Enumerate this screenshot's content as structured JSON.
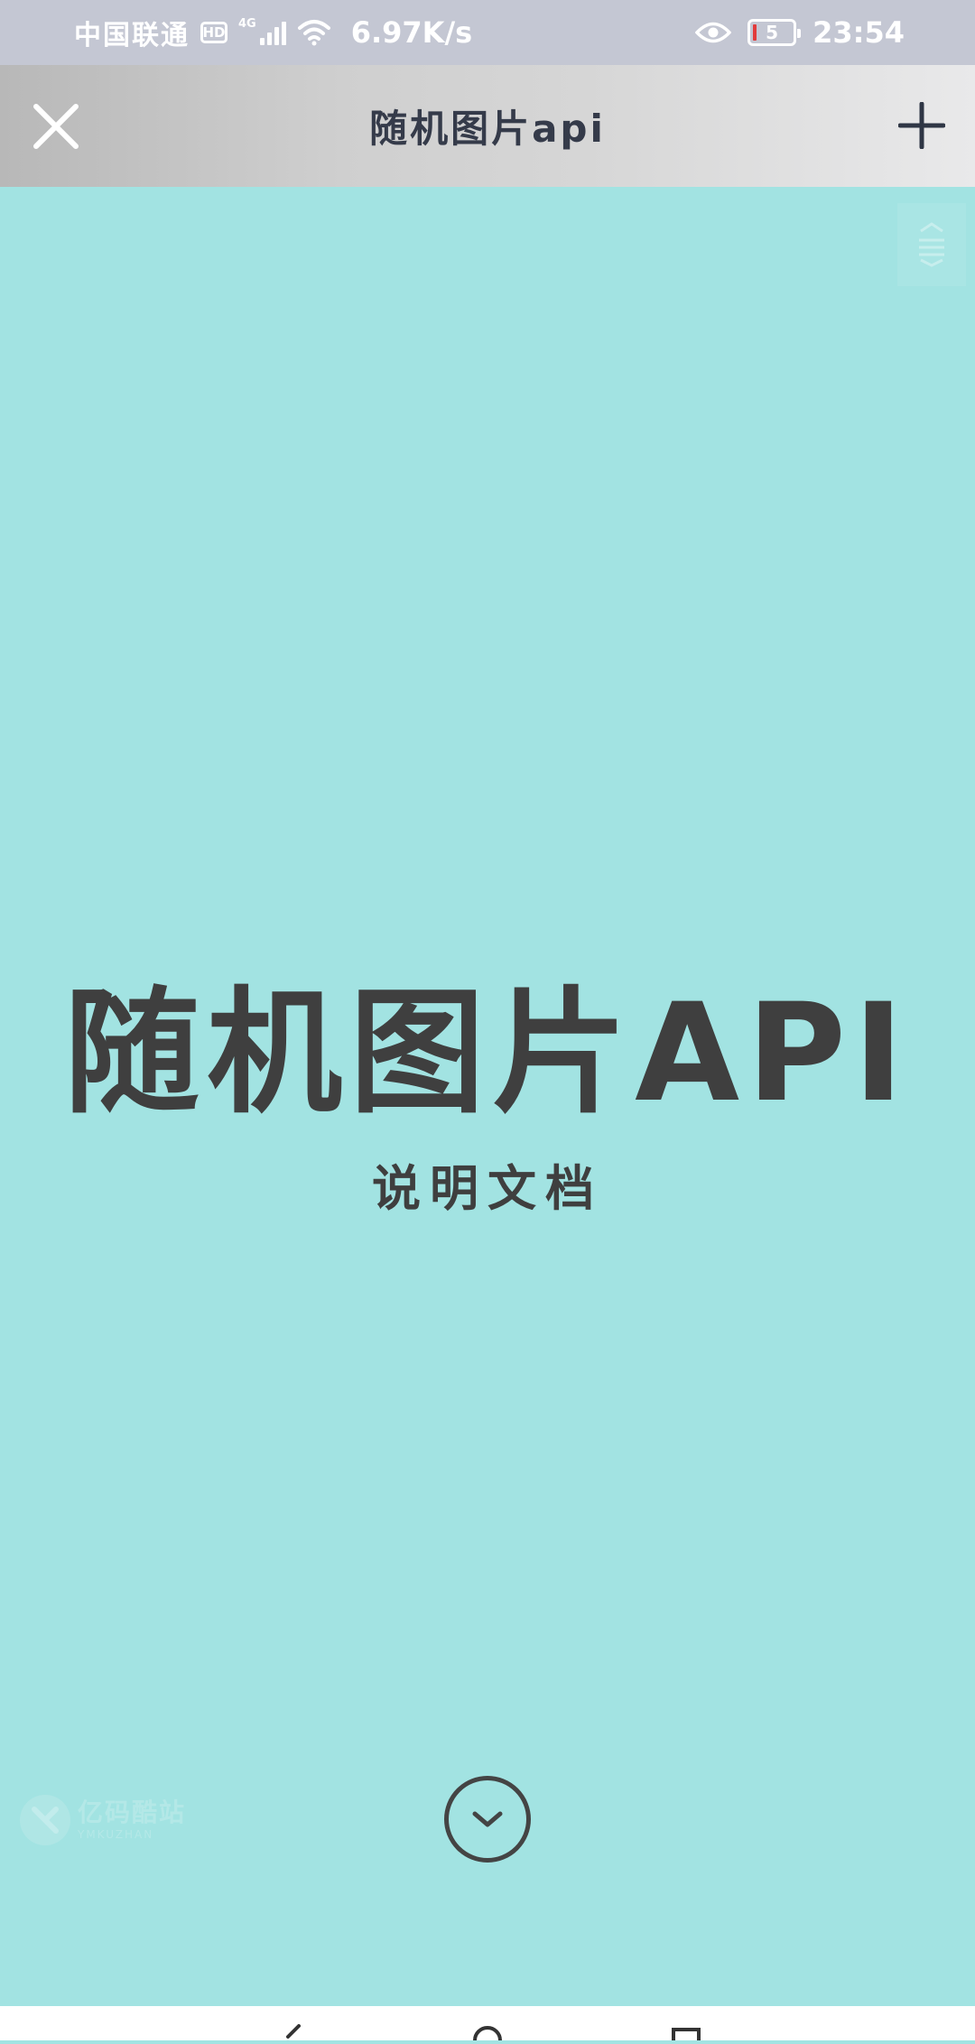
{
  "status_bar": {
    "carrier": "中国联通",
    "hd_badge": "HD",
    "network_type": "4G",
    "speed": "6.97K/s",
    "battery_level": "5",
    "time": "23:54",
    "icons": [
      "hd-icon",
      "signal-icon",
      "wifi-icon",
      "eye-icon",
      "battery-icon"
    ]
  },
  "title_bar": {
    "title": "随机图片api",
    "close_icon": "close-icon",
    "add_icon": "plus-icon"
  },
  "menu": {
    "icon": "menu-icon"
  },
  "hero": {
    "title": "随机图片API",
    "subtitle": "说明文档",
    "scroll_icon": "chevron-down-icon"
  },
  "watermark": {
    "text_cn": "亿码酷站",
    "text_en": "YMKUZHAN"
  },
  "colors": {
    "background": "#a2e3e2",
    "status_bar": "#c4c7d3",
    "title_text": "#353b4a",
    "hero_text": "#3f3f3f",
    "battery_low": "#e23b3b"
  }
}
